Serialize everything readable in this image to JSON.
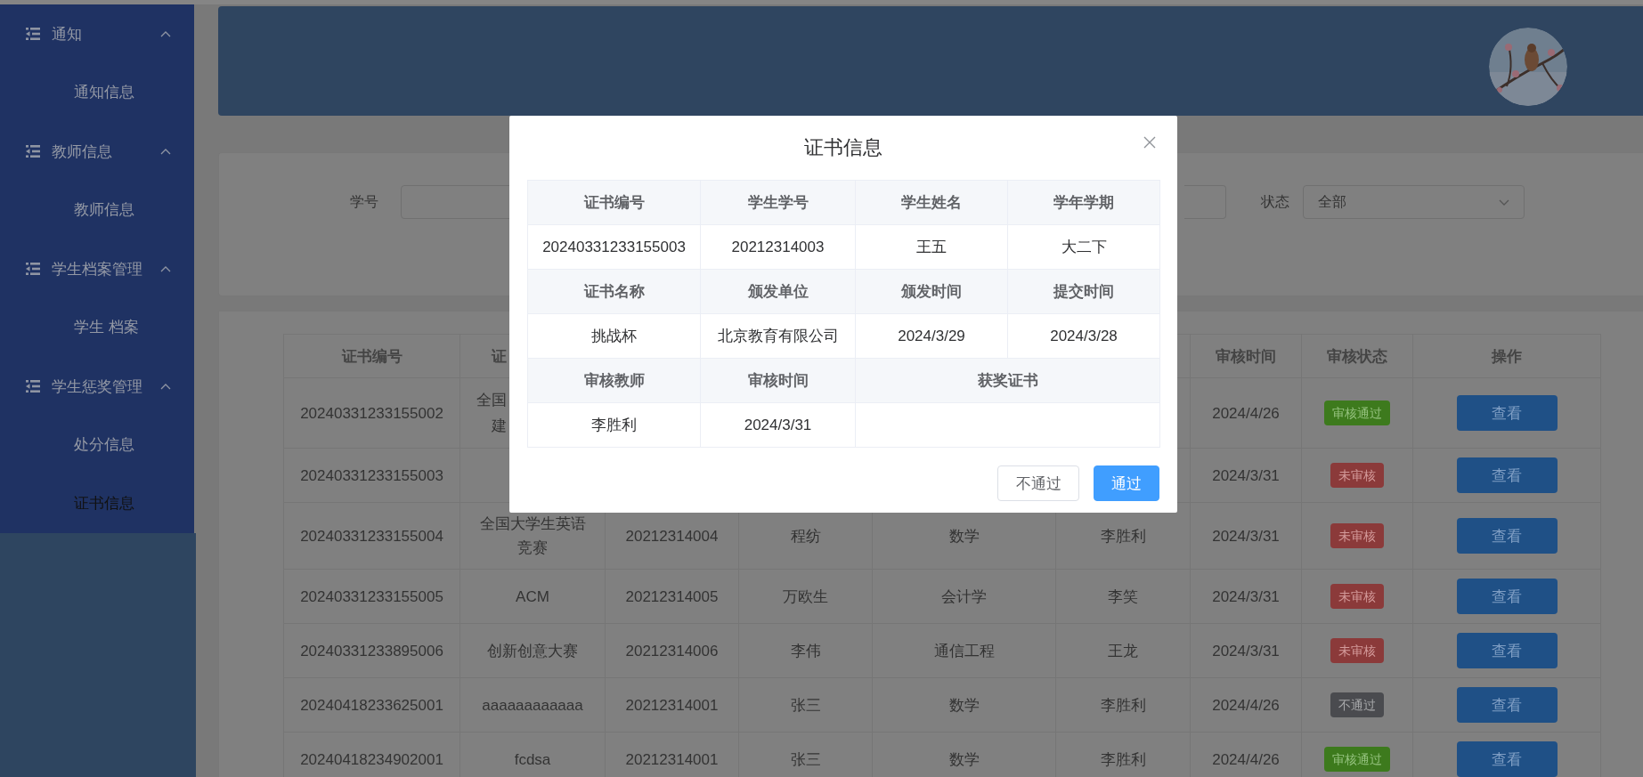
{
  "sidebar": {
    "groups": [
      {
        "title": "通知",
        "expanded": true,
        "items": [
          {
            "label": "通知信息",
            "selected": false
          }
        ]
      },
      {
        "title": "教师信息",
        "expanded": true,
        "items": [
          {
            "label": "教师信息",
            "selected": false
          }
        ]
      },
      {
        "title": "学生档案管理",
        "expanded": true,
        "items": [
          {
            "label": "学生 档案",
            "selected": false
          }
        ]
      },
      {
        "title": "学生惩奖管理",
        "expanded": true,
        "items": [
          {
            "label": "处分信息",
            "selected": false
          },
          {
            "label": "证书信息",
            "selected": true
          }
        ]
      }
    ]
  },
  "filters": {
    "student_no_label": "学号",
    "status_label": "状态",
    "status_value": "全部"
  },
  "table": {
    "columns": {
      "cert_no": "证书编号",
      "column_2": "证",
      "review_time": "审核时间",
      "status": "审核状态",
      "action": "操作"
    },
    "rows": [
      {
        "cert_no": "20240331233155002",
        "column_2": [
          "全国",
          "建"
        ],
        "review_time": "2024/4/26",
        "status": {
          "kind": "approved",
          "label": "审核通过"
        },
        "action": "查看"
      },
      {
        "cert_no": "20240331233155003",
        "review_time": "2024/3/31",
        "status": {
          "kind": "pending",
          "label": "未审核"
        },
        "action": "查看"
      },
      {
        "cert_no": "20240331233155004",
        "column_2": "全国大学生英语竞赛",
        "column_3": "20212314004",
        "column_4": "程纺",
        "column_5": "数学",
        "column_6": "李胜利",
        "review_time": "2024/3/31",
        "status": {
          "kind": "pending",
          "label": "未审核"
        },
        "action": "查看"
      },
      {
        "cert_no": "20240331233155005",
        "column_2": "ACM",
        "column_3": "20212314005",
        "column_4": "万欧生",
        "column_5": "会计学",
        "column_6": "李笑",
        "review_time": "2024/3/31",
        "status": {
          "kind": "pending",
          "label": "未审核"
        },
        "action": "查看"
      },
      {
        "cert_no": "20240331233895006",
        "column_2": "创新创意大赛",
        "column_3": "20212314006",
        "column_4": "李伟",
        "column_5": "通信工程",
        "column_6": "王龙",
        "review_time": "2024/3/31",
        "status": {
          "kind": "pending",
          "label": "未审核"
        },
        "action": "查看"
      },
      {
        "cert_no": "20240418233625001",
        "column_2": "aaaaaaaaaaaa",
        "column_3": "20212314001",
        "column_4": "张三",
        "column_5": "数学",
        "column_6": "李胜利",
        "review_time": "2024/4/26",
        "status": {
          "kind": "rejected",
          "label": "不通过"
        },
        "action": "查看"
      },
      {
        "cert_no": "20240418234902001",
        "column_2": "fcdsa",
        "column_3": "20212314001",
        "column_4": "张三",
        "column_5": "数学",
        "column_6": "李胜利",
        "review_time": "2024/4/26",
        "status": {
          "kind": "approved",
          "label": "审核通过"
        },
        "action": "查看"
      }
    ]
  },
  "dialog": {
    "title": "证书信息",
    "fields": [
      {
        "kind": "text",
        "label": "证书编号",
        "value": "20240331233155003"
      },
      {
        "kind": "text",
        "label": "学生学号",
        "value": "20212314003"
      },
      {
        "kind": "text",
        "label": "学生姓名",
        "value": "王五"
      },
      {
        "kind": "text",
        "label": "学年学期",
        "value": "大二下"
      },
      {
        "kind": "text",
        "label": "证书名称",
        "value": "挑战杯"
      },
      {
        "kind": "text",
        "label": "颁发单位",
        "value": "北京教育有限公司"
      },
      {
        "kind": "text",
        "label": "颁发时间",
        "value": "2024/3/29"
      },
      {
        "kind": "text",
        "label": "提交时间",
        "value": "2024/3/28"
      },
      {
        "kind": "text",
        "label": "审核教师",
        "value": "李胜利"
      },
      {
        "kind": "text",
        "label": "审核时间",
        "value": "2024/3/31"
      },
      {
        "label": "获奖证书"
      }
    ],
    "buttons": [
      {
        "kind": "default",
        "label": "不通过"
      },
      {
        "kind": "primary",
        "label": "通过"
      }
    ]
  }
}
